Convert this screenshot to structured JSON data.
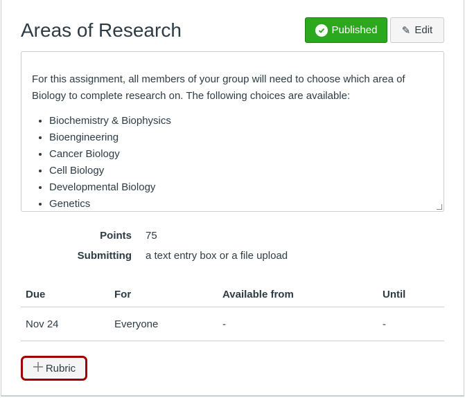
{
  "title": "Areas of Research",
  "published_label": "Published",
  "edit_label": "Edit",
  "description": {
    "intro": "For this assignment, all members of your group will need to choose which area of Biology to complete research on. The following choices are available:",
    "items": [
      "Biochemistry & Biophysics",
      "Bioengineering",
      "Cancer Biology",
      "Cell Biology",
      "Developmental Biology",
      "Genetics"
    ]
  },
  "details": {
    "points_label": "Points",
    "points_value": "75",
    "submitting_label": "Submitting",
    "submitting_value": "a text entry box or a file upload"
  },
  "dates": {
    "headers": [
      "Due",
      "For",
      "Available from",
      "Until"
    ],
    "rows": [
      [
        "Nov 24",
        "Everyone",
        "-",
        "-"
      ]
    ]
  },
  "rubric_label": "Rubric",
  "colors": {
    "published": "#2ba81e",
    "focus": "#a00000"
  }
}
